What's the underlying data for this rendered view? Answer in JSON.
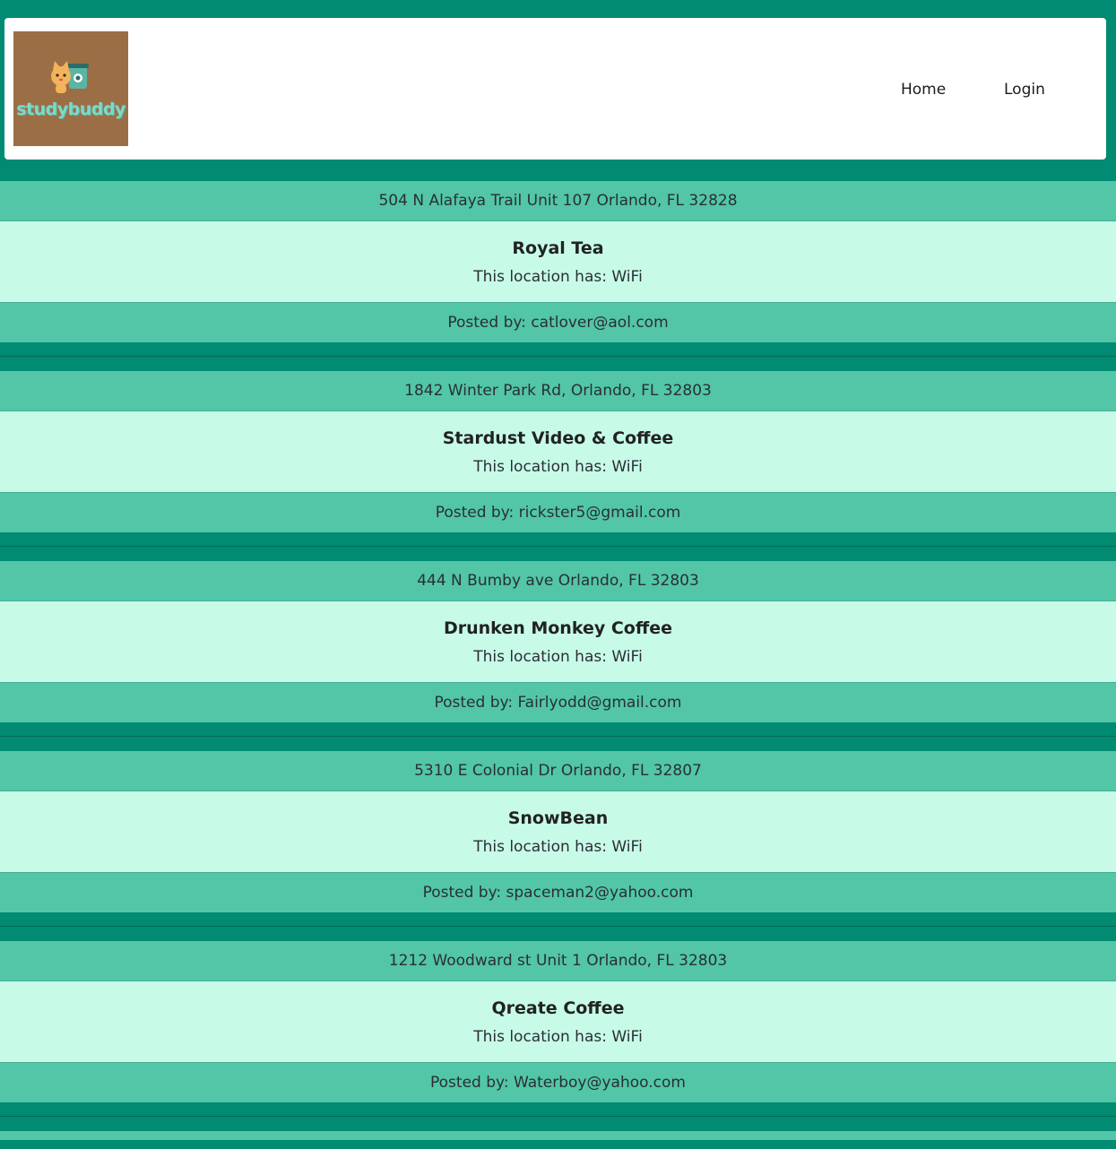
{
  "navbar": {
    "logo_text": "studybuddy",
    "links": [
      {
        "label": "Home"
      },
      {
        "label": "Login"
      }
    ]
  },
  "locations": [
    {
      "address": "504 N Alafaya Trail Unit 107 Orlando, FL 32828",
      "name": "Royal Tea",
      "amenities": "This location has: WiFi",
      "posted_by": "Posted by: catlover@aol.com"
    },
    {
      "address": "1842 Winter Park Rd, Orlando, FL 32803",
      "name": "Stardust Video & Coffee",
      "amenities": "This location has: WiFi",
      "posted_by": "Posted by: rickster5@gmail.com"
    },
    {
      "address": "444 N Bumby ave Orlando, FL 32803",
      "name": "Drunken Monkey Coffee",
      "amenities": "This location has: WiFi",
      "posted_by": "Posted by: Fairlyodd@gmail.com"
    },
    {
      "address": "5310 E Colonial Dr Orlando, FL 32807",
      "name": "SnowBean",
      "amenities": "This location has: WiFi",
      "posted_by": "Posted by: spaceman2@yahoo.com"
    },
    {
      "address": "1212 Woodward st Unit 1 Orlando, FL 32803",
      "name": "Qreate Coffee",
      "amenities": "This location has: WiFi",
      "posted_by": "Posted by: Waterboy@yahoo.com"
    }
  ],
  "colors": {
    "page_bg": "#008b72",
    "card_header": "#52c6a7",
    "card_body": "#c7fbe8",
    "logo_bg": "#9c6e45"
  }
}
